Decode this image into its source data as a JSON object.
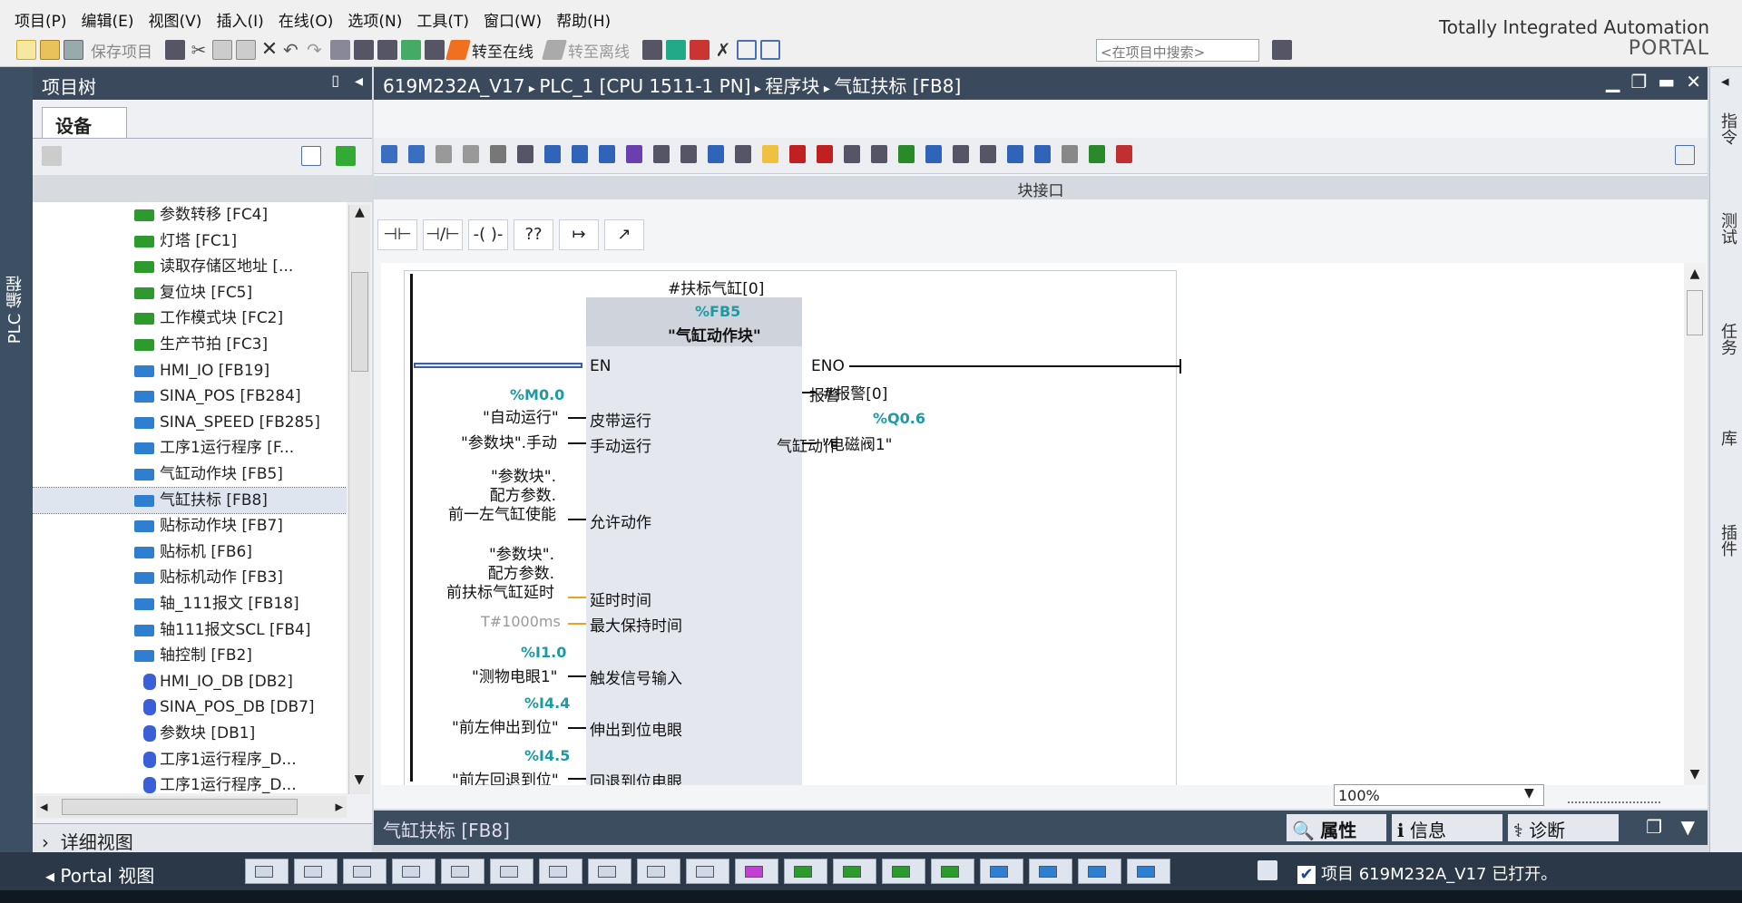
{
  "menu": [
    "项目(P)",
    "编辑(E)",
    "视图(V)",
    "插入(I)",
    "在线(O)",
    "选项(N)",
    "工具(T)",
    "窗口(W)",
    "帮助(H)"
  ],
  "toolbar": {
    "save_project": "保存项目",
    "go_online": "转至在线",
    "go_offline": "转至离线",
    "search_placeholder": "<在项目中搜索>"
  },
  "brand": {
    "line1": "Totally Integrated Automation",
    "line2": "PORTAL"
  },
  "left_strip_label": "PLC 编程",
  "project_tree": {
    "title": "项目树",
    "tab": "设备",
    "items": [
      {
        "label": "参数转移 [FC4]",
        "type": "fc"
      },
      {
        "label": "灯塔 [FC1]",
        "type": "fc"
      },
      {
        "label": "读取存储区地址 [...",
        "type": "fc"
      },
      {
        "label": "复位块 [FC5]",
        "type": "fc"
      },
      {
        "label": "工作模式块 [FC2]",
        "type": "fc"
      },
      {
        "label": "生产节拍 [FC3]",
        "type": "fc"
      },
      {
        "label": "HMI_IO [FB19]",
        "type": "fb"
      },
      {
        "label": "SINA_POS [FB284]",
        "type": "fb"
      },
      {
        "label": "SINA_SPEED [FB285]",
        "type": "fb"
      },
      {
        "label": "工序1运行程序 [F...",
        "type": "fb"
      },
      {
        "label": "气缸动作块 [FB5]",
        "type": "fb"
      },
      {
        "label": "气缸扶标 [FB8]",
        "type": "fb",
        "selected": true
      },
      {
        "label": "贴标动作块 [FB7]",
        "type": "fb"
      },
      {
        "label": "贴标机 [FB6]",
        "type": "fb"
      },
      {
        "label": "贴标机动作 [FB3]",
        "type": "fb"
      },
      {
        "label": "轴_111报文 [FB18]",
        "type": "fb"
      },
      {
        "label": "轴111报文SCL [FB4]",
        "type": "fb"
      },
      {
        "label": "轴控制 [FB2]",
        "type": "fb"
      },
      {
        "label": "HMI_IO_DB [DB2]",
        "type": "db"
      },
      {
        "label": "SINA_POS_DB [DB7]",
        "type": "db"
      },
      {
        "label": "参数块 [DB1]",
        "type": "db"
      },
      {
        "label": "工序1运行程序_D...",
        "type": "db"
      },
      {
        "label": "工序1运行程序_D...",
        "type": "db"
      }
    ],
    "detail_view": "详细视图"
  },
  "editor": {
    "breadcrumb": [
      "619M232A_V17",
      "PLC_1 [CPU 1511-1 PN]",
      "程序块",
      "气缸扶标 [FB8]"
    ],
    "block_interface": "块接口",
    "instance": "#扶标气缸[0]",
    "fb_addr": "%FB5",
    "fb_name": "\"气缸动作块\"",
    "en": "EN",
    "eno": "ENO",
    "inputs": [
      {
        "addr": "%M0.0",
        "operand": "\"自动运行\"",
        "pin": "皮带运行"
      },
      {
        "addr": "",
        "operand": "\"参数块\".手动",
        "pin": "手动运行"
      },
      {
        "addr": "",
        "operand": "\"参数块\".\n配方参数.\n前一左气缸使能",
        "pin": "允许动作"
      },
      {
        "addr": "",
        "operand": "\"参数块\".\n配方参数.\n前扶标气缸延时",
        "pin": "延时时间"
      },
      {
        "addr": "",
        "operand": "T#1000ms",
        "pin": "最大保持时间"
      },
      {
        "addr": "%I1.0",
        "operand": "\"测物电眼1\"",
        "pin": "触发信号输入"
      },
      {
        "addr": "%I4.4",
        "operand": "\"前左伸出到位\"",
        "pin": "伸出到位电眼"
      },
      {
        "addr": "%I4.5",
        "operand": "\"前左回退到位\"",
        "pin": "回退到位电眼"
      }
    ],
    "outputs": [
      {
        "pin": "报警",
        "addr": "",
        "operand": "#报警[0]"
      },
      {
        "pin": "气缸动作",
        "addr": "%Q0.6",
        "operand": "\"电磁阀1\""
      }
    ],
    "zoom": "100%",
    "lad_buttons": [
      "⊣⊢",
      "⊣/⊢",
      "-( )-",
      "??",
      "↦",
      "↗"
    ]
  },
  "properties_bar": {
    "title": "气缸扶标 [FB8]",
    "tabs": [
      "属性",
      "信息",
      "诊断"
    ]
  },
  "right_strip": [
    "指令",
    "测试",
    "任务",
    "库",
    "插件"
  ],
  "status": {
    "portal_view": "Portal 视图",
    "message": "项目 619M232A_V17 已打开。"
  }
}
